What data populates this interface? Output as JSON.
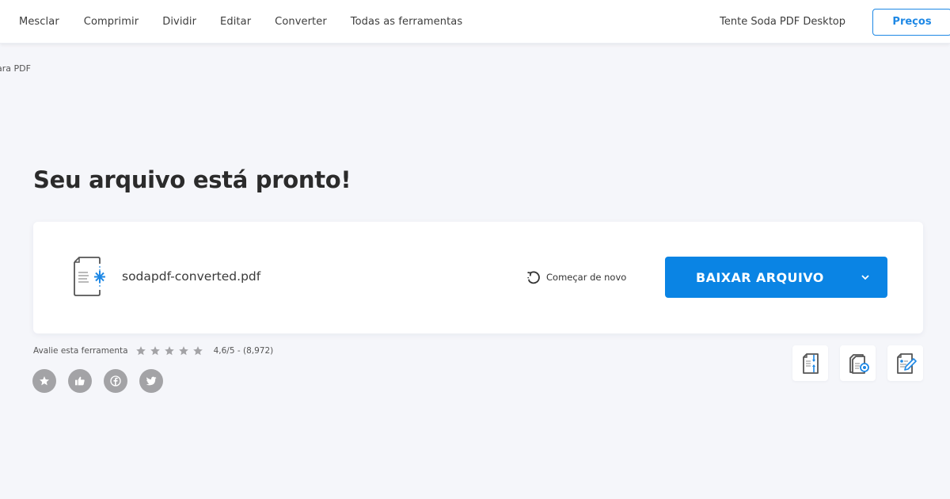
{
  "header": {
    "nav": [
      {
        "label": "Mesclar"
      },
      {
        "label": "Comprimir"
      },
      {
        "label": "Dividir"
      },
      {
        "label": "Editar"
      },
      {
        "label": "Converter"
      },
      {
        "label": "Todas as ferramentas"
      }
    ],
    "desktop_link": "Tente Soda PDF Desktop",
    "pricing_label": "Preços"
  },
  "breadcrumb": "ara PDF",
  "title": "Seu arquivo está pronto!",
  "file": {
    "name": "sodapdf-converted.pdf",
    "icon": "converted-file-icon"
  },
  "actions": {
    "restart_label": "Começar de novo",
    "restart_icon": "restart-icon",
    "download_label": "BAIXAR ARQUIVO",
    "download_icon": "chevron-down-icon"
  },
  "rating": {
    "label": "Avalie esta ferramenta",
    "stars_total": 5,
    "score_text": "4,6/5 - (8,972)"
  },
  "social": [
    {
      "name": "favorite-icon"
    },
    {
      "name": "like-icon"
    },
    {
      "name": "facebook-icon"
    },
    {
      "name": "twitter-icon"
    }
  ],
  "tools": [
    {
      "name": "split-pdf-icon"
    },
    {
      "name": "compress-pdf-icon"
    },
    {
      "name": "edit-pdf-icon"
    }
  ],
  "colors": {
    "accent": "#0a84e4",
    "background": "#f5f6fa",
    "icon_gray": "#a3a3a6"
  }
}
